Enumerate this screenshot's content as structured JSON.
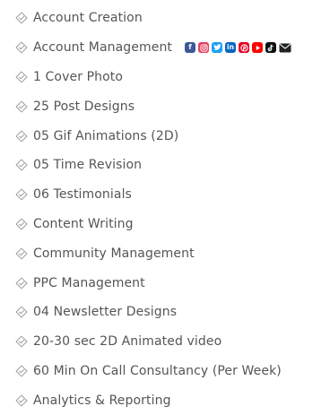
{
  "features": [
    {
      "label": "Account Creation"
    },
    {
      "label": "Account Management"
    },
    {
      "label": "1 Cover Photo"
    },
    {
      "label": "25 Post Designs"
    },
    {
      "label": "05 Gif Animations (2D)"
    },
    {
      "label": "05 Time Revision"
    },
    {
      "label": "06 Testimonials"
    },
    {
      "label": "Content Writing"
    },
    {
      "label": "Community Management"
    },
    {
      "label": "PPC Management"
    },
    {
      "label": "04 Newsletter Designs"
    },
    {
      "label": "20-30 sec 2D Animated video"
    },
    {
      "label": "60 Min On Call Consultancy (Per Week)"
    },
    {
      "label": "Analytics & Reporting"
    }
  ],
  "check_icon": "diamond-check-icon",
  "social_icons": [
    {
      "name": "facebook-icon",
      "color": "#3b5998"
    },
    {
      "name": "instagram-icon",
      "color": "#e4405f"
    },
    {
      "name": "twitter-icon",
      "color": "#1da1f2"
    },
    {
      "name": "linkedin-icon",
      "color": "#0a66c2"
    },
    {
      "name": "pinterest-icon",
      "color": "#e60023"
    },
    {
      "name": "youtube-icon",
      "color": "#ff0000"
    },
    {
      "name": "tiktok-icon",
      "color": "#111111"
    },
    {
      "name": "email-icon",
      "color": "#222222"
    }
  ],
  "colors": {
    "text": "#555555",
    "check": "#9a9a9a",
    "background": "#ffffff"
  }
}
